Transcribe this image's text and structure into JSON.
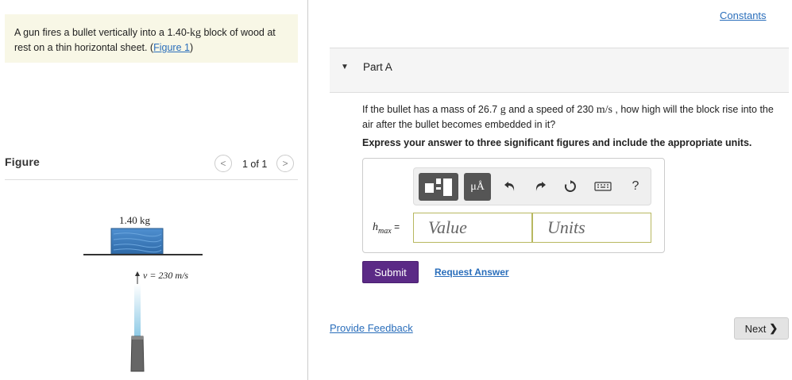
{
  "problem": {
    "text_before": "A gun fires a bullet vertically into a 1.40-",
    "unit_kg": "kg",
    "text_after": " block of wood at rest on a thin horizontal sheet. (",
    "figure_link": "Figure 1",
    "text_end": ")"
  },
  "figure": {
    "label": "Figure",
    "counter": "1 of 1",
    "block_mass_label": "1.40 kg",
    "velocity_label": "v = 230 m/s"
  },
  "header": {
    "constants_link": "Constants"
  },
  "part_a": {
    "title": "Part A",
    "question_1": "If the bullet has a mass of 26.7 ",
    "mass_unit": "g",
    "question_2": " and a speed of 230 ",
    "speed_unit": "m/s",
    "question_3": " , how high will the block rise into the air after the bullet becomes embedded in it?",
    "instruction": "Express your answer to three significant figures and include the appropriate units."
  },
  "toolbar": {
    "units_label": "μÅ",
    "help_label": "?"
  },
  "answer": {
    "variable": "h",
    "variable_sub": "max",
    "equals": "=",
    "value_placeholder": "Value",
    "units_placeholder": "Units"
  },
  "actions": {
    "submit_label": "Submit",
    "request_answer_label": "Request Answer",
    "feedback_label": "Provide Feedback",
    "next_label": "Next"
  },
  "colors": {
    "problem_bg": "#f8f7e6",
    "link": "#2a6ebb",
    "submit_bg": "#5b2a86",
    "block_fill": "#3d7bbf"
  }
}
